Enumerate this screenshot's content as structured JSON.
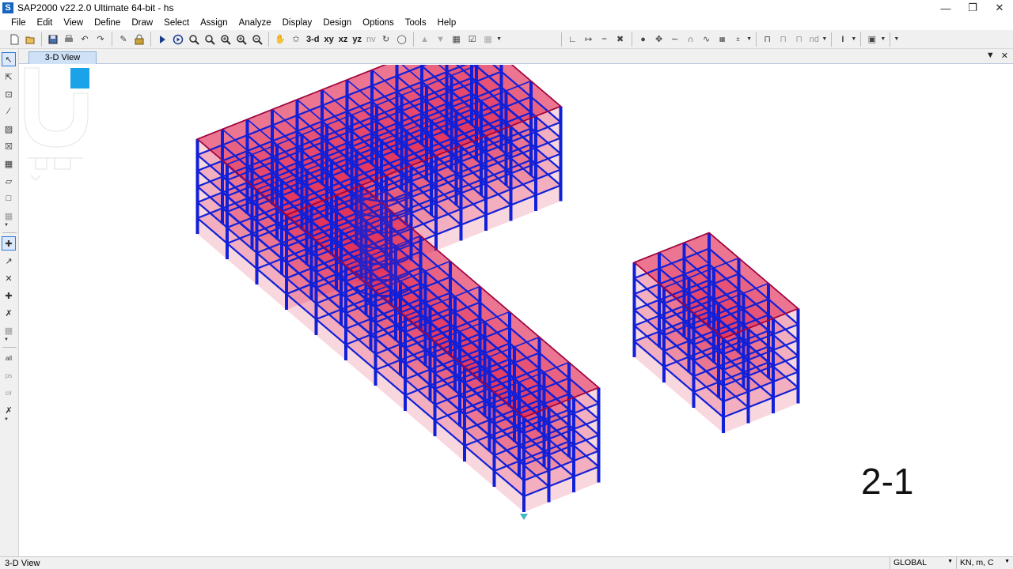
{
  "window": {
    "app_icon": "S",
    "title": "SAP2000 v22.2.0 Ultimate 64-bit - hs",
    "controls": [
      "minimize-icon",
      "restore-icon",
      "close-icon"
    ]
  },
  "menu": [
    "File",
    "Edit",
    "View",
    "Define",
    "Draw",
    "Select",
    "Assign",
    "Analyze",
    "Display",
    "Design",
    "Options",
    "Tools",
    "Help"
  ],
  "toolbar": {
    "view_3d": "3-d",
    "view_xy": "xy",
    "view_xz": "xz",
    "view_yz": "yz",
    "view_nv": "nv",
    "nd_label": "nd"
  },
  "tabs": {
    "active_label": "3-D View"
  },
  "viewport": {
    "overlay_text": "2-1",
    "model_colors": {
      "slab_fill": "#e0204e",
      "frame_line": "#1020d8",
      "edge_line": "#b0002a"
    }
  },
  "status": {
    "view_name": "3-D View",
    "coord_system": "GLOBAL",
    "units": "KN, m, C"
  },
  "colors": {
    "accent": "#2f7ad6",
    "logo_white": "#ffffff",
    "logo_blue": "#1aa3e8"
  }
}
